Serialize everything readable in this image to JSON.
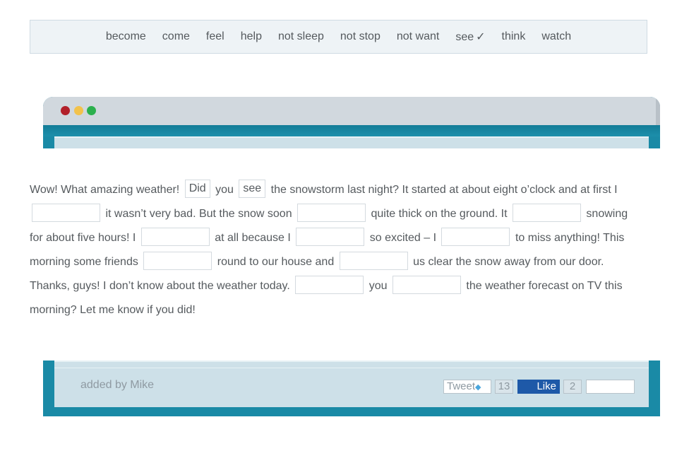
{
  "word_bank": [
    "become",
    "come",
    "feel",
    "help",
    "not sleep",
    "not stop",
    "not want",
    "see",
    "think",
    "watch"
  ],
  "word_bank_used_mark": "✓",
  "exercise": {
    "t1": "Wow! What amazing weather!",
    "g1": "Did",
    "t2": "you",
    "g2": "see",
    "t3": "the snowstorm last night? It started at about eight o’clock and at first I",
    "t4": "it wasn’t very bad. But the snow soon",
    "t5": "quite thick on the ground. It",
    "t6": "snowing for about five hours! I",
    "t7": "at all because I",
    "t8": "so excited – I",
    "t9": "to miss anything! This morning some friends",
    "t10": "round to our house and",
    "t11": "us clear the snow away from our door. Thanks, guys! I don’t know about the weather today.",
    "t12": "you",
    "t13": "the weather forecast on TV this morning? Let me know if you did!"
  },
  "footer": {
    "added_by": "added by Mike",
    "tweet_label": "Tweet",
    "tweet_count": "13",
    "like_label": "Like",
    "like_count": "2"
  },
  "colors": {
    "frame_teal": "#1a8aa6",
    "like_blue": "#1e59a8",
    "dot_red": "#b2202a",
    "dot_yellow": "#f2c24b",
    "dot_green": "#2bb04d"
  }
}
